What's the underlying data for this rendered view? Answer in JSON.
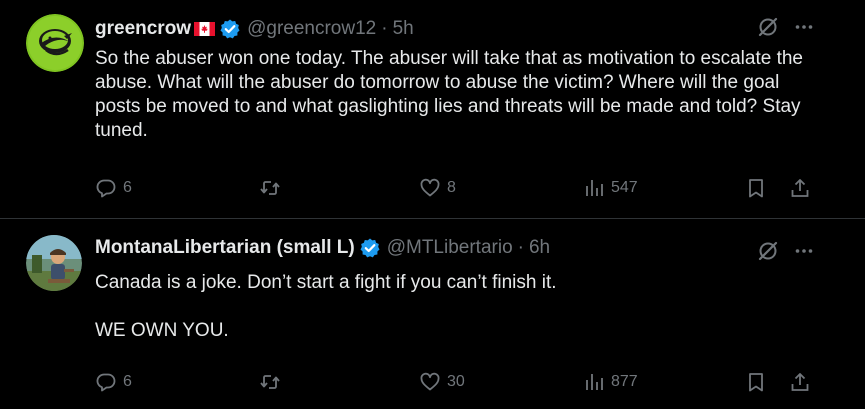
{
  "colors": {
    "background": "#000000",
    "text_primary": "#e7e9ea",
    "text_secondary": "#71767b",
    "divider": "#2f3336",
    "verified_blue": "#1d9bf0"
  },
  "tweets": [
    {
      "display_name": "greencrow",
      "flag": "canada-flag",
      "verified": true,
      "handle": "@greencrow12",
      "separator": "·",
      "time": "5h",
      "text": [
        "So the abuser won one today. The abuser will take that as motivation to escalate the abuse.  What will the abuser do tomorrow to abuse the victim? Where will the goal posts be moved to and what gaslighting lies and threats will be made and told? Stay tuned."
      ],
      "replies": "6",
      "reposts": "",
      "likes": "8",
      "views": "547",
      "avatar_icon": "green-crow-logo-avatar"
    },
    {
      "display_name": "MontanaLibertarian (small L)",
      "verified": true,
      "handle": "@MTLibertario",
      "separator": "·",
      "time": "6h",
      "text": [
        "Canada is a joke. Don’t start a fight if you can’t finish it.",
        "WE OWN YOU."
      ],
      "replies": "6",
      "reposts": "",
      "likes": "30",
      "views": "877",
      "avatar_icon": "cartoon-person-avatar"
    }
  ],
  "icons": {
    "grok": "grok-icon",
    "more": "more-icon",
    "reply": "reply-icon",
    "repost": "repost-icon",
    "like": "heart-icon",
    "views": "views-icon",
    "bookmark": "bookmark-icon",
    "share": "share-icon"
  }
}
